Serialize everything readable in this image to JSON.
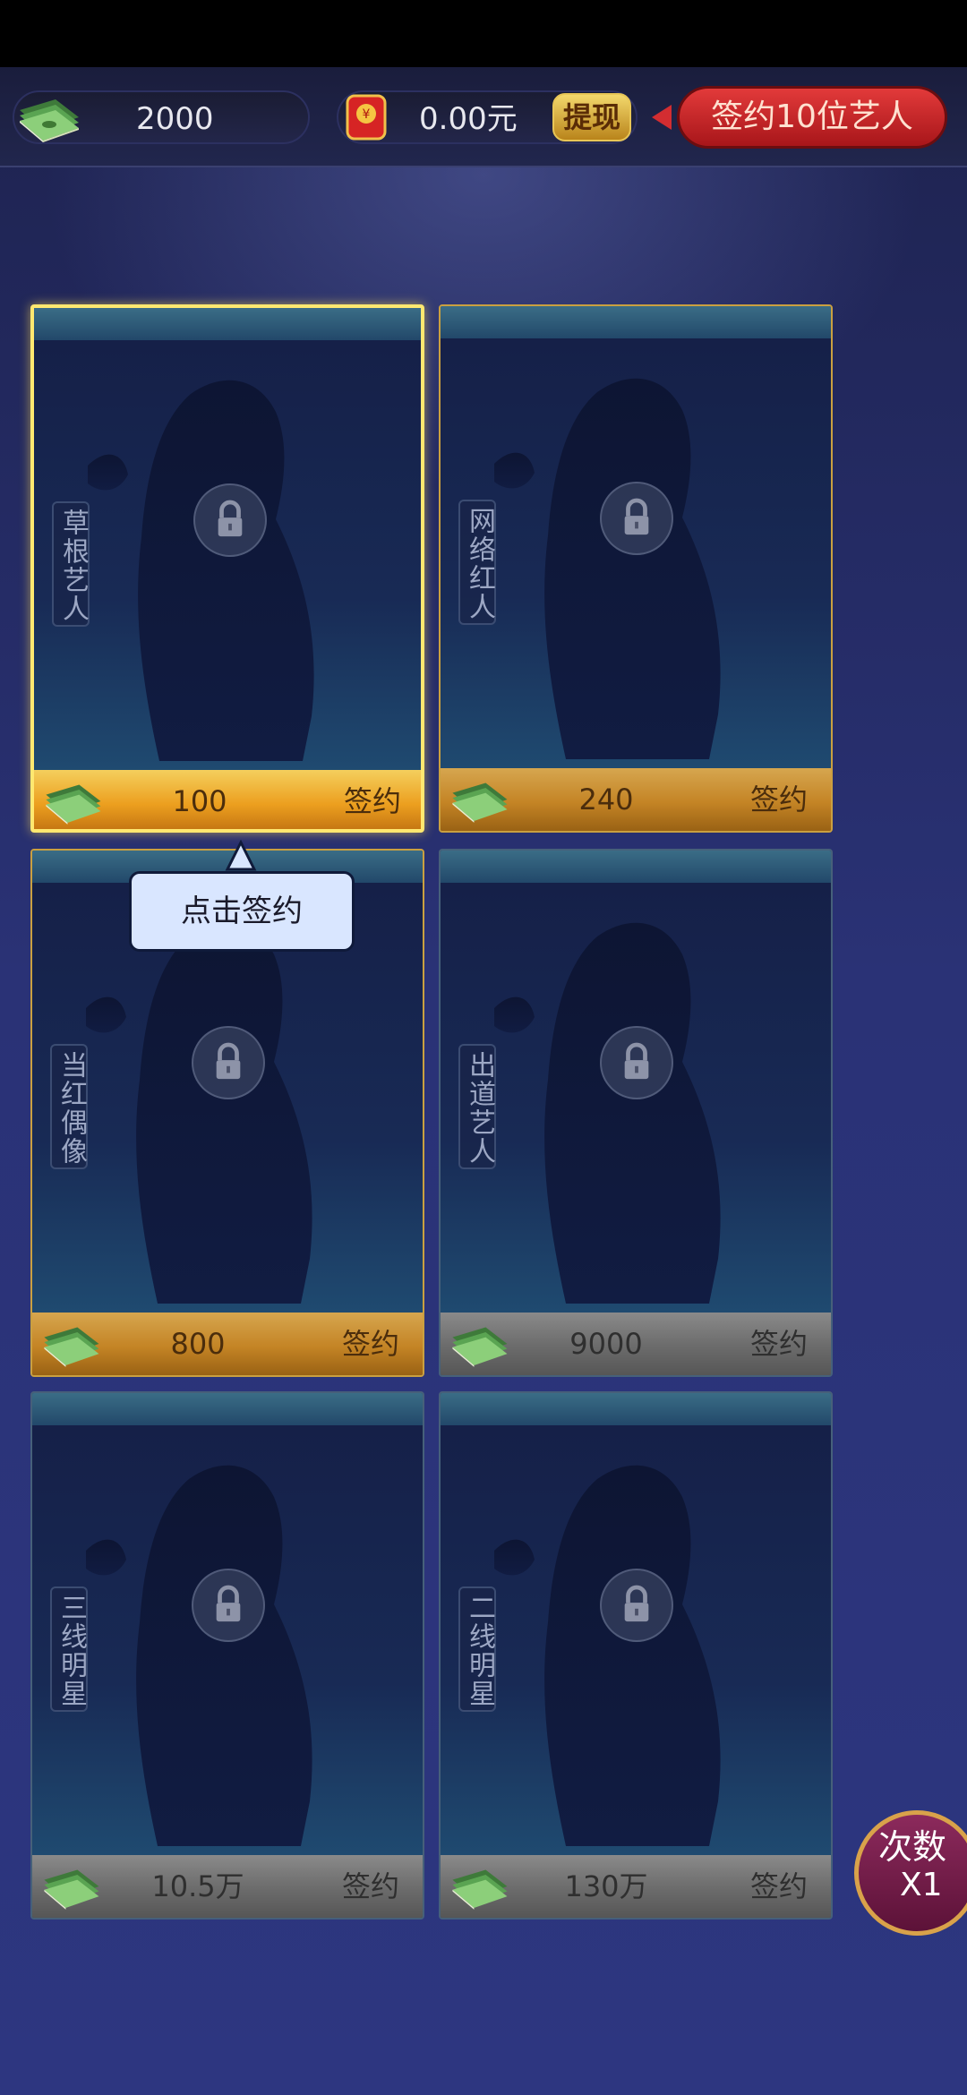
{
  "header": {
    "cash_amount": "2000",
    "money_amount": "0.00元",
    "withdraw_label": "提现",
    "sign_ten_label": "签约10位艺人"
  },
  "cards": [
    {
      "tier": "草根艺人",
      "price": "100",
      "action": "签约",
      "state": "affordable"
    },
    {
      "tier": "网络红人",
      "price": "240",
      "action": "签约",
      "state": "affordable"
    },
    {
      "tier": "当红偶像",
      "price": "800",
      "action": "签约",
      "state": "affordable"
    },
    {
      "tier": "出道艺人",
      "price": "9000",
      "action": "签约",
      "state": "locked"
    },
    {
      "tier": "三线明星",
      "price": "10.5万",
      "action": "签约",
      "state": "locked"
    },
    {
      "tier": "二线明星",
      "price": "130万",
      "action": "签约",
      "state": "locked"
    }
  ],
  "tooltip": {
    "text": "点击签约"
  },
  "times_button": {
    "label": "次数",
    "value": "X1"
  },
  "icons": [
    "cash-stack-icon",
    "red-envelope-icon",
    "lock-icon",
    "silhouette-image"
  ],
  "colors": {
    "gold": "#ec9f1f",
    "red": "#c82126",
    "background": "#26306a"
  }
}
